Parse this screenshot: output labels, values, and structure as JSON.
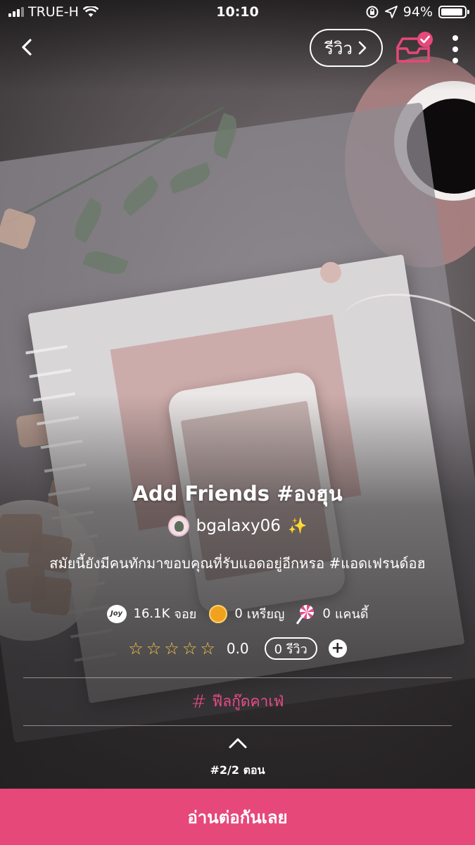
{
  "status_bar": {
    "carrier": "TRUE-H",
    "time": "10:10",
    "battery": "94%",
    "battery_level": 0.94,
    "icons": [
      "signal-icon",
      "wifi-icon",
      "orientation-lock-icon",
      "location-icon",
      "battery-icon"
    ]
  },
  "topbar": {
    "review_label": "รีวิว",
    "icons": [
      "back-icon",
      "chevron-right-icon",
      "library-check-icon",
      "more-icon"
    ]
  },
  "story": {
    "title": "Add Friends #องฮุน",
    "author": "bgalaxy06",
    "author_emoji": "✨",
    "description": "สมัยนี้ยังมีคนทักมาขอบคุณที่รับแอดอยู่อีกหรอ #แอดเฟรนด์อฮ",
    "stats": [
      {
        "icon": "joy-icon",
        "icon_text": "Joy",
        "value": "16.1K",
        "label": "จอย"
      },
      {
        "icon": "coin-icon",
        "value": "0",
        "label": "เหรียญ"
      },
      {
        "icon": "candy-icon",
        "value": "0",
        "label": "แคนดี้"
      }
    ],
    "rating": {
      "stars": 0,
      "max_stars": 5,
      "value": "0.0",
      "reviews": "0 รีวิว"
    },
    "tag": "ฟีลกู๊ดคาเฟ่",
    "episode": "#2/2 ตอน"
  },
  "cta": {
    "label": "อ่านต่อกันเลย"
  },
  "colors": {
    "accent": "#e6487a",
    "star": "#f6c84a",
    "coin": "#f0a21f"
  }
}
